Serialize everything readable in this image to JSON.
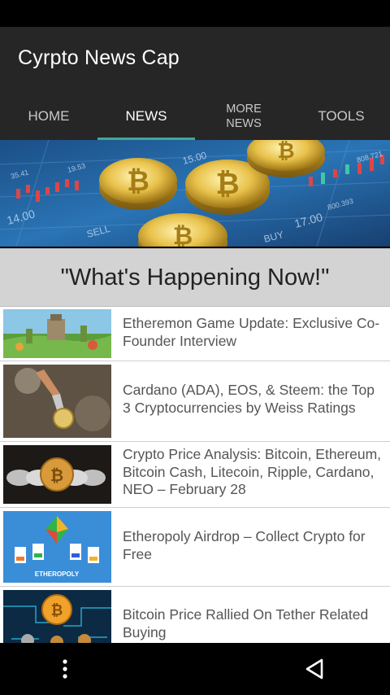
{
  "app": {
    "title": "Cyrpto News Cap"
  },
  "tabs": [
    {
      "label": "HOME"
    },
    {
      "label": "NEWS"
    },
    {
      "label": "MORE\nNEWS"
    },
    {
      "label": "TOOLS"
    }
  ],
  "active_tab": "NEWS",
  "banner": {
    "numbers": [
      "808.721",
      "14.00",
      "17.00",
      "800.393",
      "15.00",
      "SELL",
      "BUY",
      "35.41",
      "19.53"
    ]
  },
  "headline": "\"What's Happening Now!\"",
  "news": [
    {
      "title": "Etheremon Game Update: Exclusive Co-Founder Interview"
    },
    {
      "title": "Cardano (ADA), EOS, & Steem: the Top 3 Cryptocurrencies by Weiss Ratings"
    },
    {
      "title": "Crypto Price Analysis: Bitcoin, Ethereum, Bitcoin Cash, Litecoin, Ripple, Cardano, NEO – February 28"
    },
    {
      "title": "Etheropoly Airdrop – Collect Crypto for Free",
      "thumb_label": "ETHEROPOLY"
    },
    {
      "title": "Bitcoin Price Rallied On Tether Related Buying"
    }
  ],
  "navigation": {
    "menu_icon": "more-vert-icon",
    "back_icon": "back-icon"
  },
  "colors": {
    "app_bar": "#262626",
    "tab_indicator": "#3fa89a",
    "headline_bg": "#d3d3d3",
    "item_text": "#555555"
  }
}
